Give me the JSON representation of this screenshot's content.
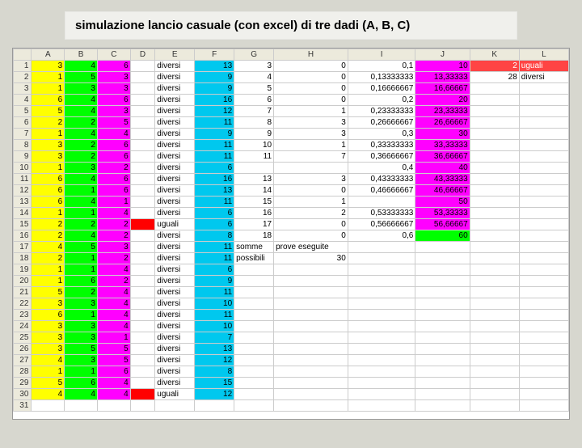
{
  "title": "simulazione lancio casuale (con excel) di tre dadi (A, B, C)",
  "columns": [
    "A",
    "B",
    "C",
    "D",
    "E",
    "F",
    "G",
    "H",
    "I",
    "J",
    "K",
    "L"
  ],
  "rows": [
    {
      "r": "1",
      "A": "3",
      "B": "4",
      "C": "6",
      "E": "diversi",
      "F": "13",
      "G": "3",
      "H": "0",
      "I": "0,1",
      "J": "10",
      "K": "2",
      "L": "uguali"
    },
    {
      "r": "2",
      "A": "1",
      "B": "5",
      "C": "3",
      "E": "diversi",
      "F": "9",
      "G": "4",
      "H": "0",
      "I": "0,13333333",
      "J": "13,33333",
      "K": "28",
      "L": "diversi"
    },
    {
      "r": "3",
      "A": "1",
      "B": "3",
      "C": "3",
      "E": "diversi",
      "F": "9",
      "G": "5",
      "H": "0",
      "I": "0,16666667",
      "J": "16,66667"
    },
    {
      "r": "4",
      "A": "6",
      "B": "4",
      "C": "6",
      "E": "diversi",
      "F": "16",
      "G": "6",
      "H": "0",
      "I": "0,2",
      "J": "20"
    },
    {
      "r": "5",
      "A": "5",
      "B": "4",
      "C": "3",
      "E": "diversi",
      "F": "12",
      "G": "7",
      "H": "1",
      "I": "0,23333333",
      "J": "23,33333"
    },
    {
      "r": "6",
      "A": "2",
      "B": "2",
      "C": "5",
      "E": "diversi",
      "F": "11",
      "G": "8",
      "H": "3",
      "I": "0,26666667",
      "J": "26,66667"
    },
    {
      "r": "7",
      "A": "1",
      "B": "4",
      "C": "4",
      "E": "diversi",
      "F": "9",
      "G": "9",
      "H": "3",
      "I": "0,3",
      "J": "30"
    },
    {
      "r": "8",
      "A": "3",
      "B": "2",
      "C": "6",
      "E": "diversi",
      "F": "11",
      "G": "10",
      "H": "1",
      "I": "0,33333333",
      "J": "33,33333"
    },
    {
      "r": "9",
      "A": "3",
      "B": "2",
      "C": "6",
      "E": "diversi",
      "F": "11",
      "G": "11",
      "H": "7",
      "I": "0,36666667",
      "J": "36,66667"
    },
    {
      "r": "10",
      "A": "1",
      "B": "3",
      "C": "2",
      "E": "diversi",
      "F": "6",
      "G": "",
      "H": "",
      "I": "0,4",
      "J": "40"
    },
    {
      "r": "11",
      "A": "6",
      "B": "4",
      "C": "6",
      "E": "diversi",
      "F": "16",
      "G": "13",
      "H": "3",
      "I": "0,43333333",
      "J": "43,33333"
    },
    {
      "r": "12",
      "A": "6",
      "B": "1",
      "C": "6",
      "E": "diversi",
      "F": "13",
      "G": "14",
      "H": "0",
      "I": "0,46666667",
      "J": "46,66667"
    },
    {
      "r": "13",
      "A": "6",
      "B": "4",
      "C": "1",
      "E": "diversi",
      "F": "11",
      "G": "15",
      "H": "1",
      "I": "",
      "J": "50"
    },
    {
      "r": "14",
      "A": "1",
      "B": "1",
      "C": "4",
      "E": "diversi",
      "F": "6",
      "G": "16",
      "H": "2",
      "I": "0,53333333",
      "J": "53,33333"
    },
    {
      "r": "15",
      "A": "2",
      "B": "2",
      "C": "2",
      "Dred": true,
      "E": "uguali",
      "F": "6",
      "G": "17",
      "H": "0",
      "I": "0,56666667",
      "J": "56,66667"
    },
    {
      "r": "16",
      "A": "2",
      "B": "4",
      "C": "2",
      "E": "diversi",
      "F": "8",
      "G": "18",
      "H": "0",
      "I": "0,6",
      "J": "60"
    },
    {
      "r": "17",
      "A": "4",
      "B": "5",
      "C": "3",
      "E": "diversi",
      "F": "11",
      "G": "somme",
      "H": "prove eseguite"
    },
    {
      "r": "18",
      "A": "2",
      "B": "1",
      "C": "2",
      "E": "diversi",
      "F": "11",
      "G": "possibili",
      "H": "30"
    },
    {
      "r": "19",
      "A": "1",
      "B": "1",
      "C": "4",
      "E": "diversi",
      "F": "6"
    },
    {
      "r": "20",
      "A": "1",
      "B": "6",
      "C": "2",
      "E": "diversi",
      "F": "9"
    },
    {
      "r": "21",
      "A": "5",
      "B": "2",
      "C": "4",
      "E": "diversi",
      "F": "11"
    },
    {
      "r": "22",
      "A": "3",
      "B": "3",
      "C": "4",
      "E": "diversi",
      "F": "10"
    },
    {
      "r": "23",
      "A": "6",
      "B": "1",
      "C": "4",
      "E": "diversi",
      "F": "11"
    },
    {
      "r": "24",
      "A": "3",
      "B": "3",
      "C": "4",
      "E": "diversi",
      "F": "10"
    },
    {
      "r": "25",
      "A": "3",
      "B": "3",
      "C": "1",
      "E": "diversi",
      "F": "7"
    },
    {
      "r": "26",
      "A": "3",
      "B": "5",
      "C": "5",
      "E": "diversi",
      "F": "13"
    },
    {
      "r": "27",
      "A": "4",
      "B": "3",
      "C": "5",
      "E": "diversi",
      "F": "12"
    },
    {
      "r": "28",
      "A": "1",
      "B": "1",
      "C": "6",
      "E": "diversi",
      "F": "8"
    },
    {
      "r": "29",
      "A": "5",
      "B": "6",
      "C": "4",
      "E": "diversi",
      "F": "15"
    },
    {
      "r": "30",
      "A": "4",
      "B": "4",
      "C": "4",
      "Dred": true,
      "E": "uguali",
      "F": "12"
    },
    {
      "r": "31"
    }
  ],
  "pinkJ": [
    true,
    true,
    true,
    true,
    true,
    true,
    true,
    true,
    true,
    true,
    true,
    true,
    true,
    true,
    true,
    true
  ],
  "greenJLast": true
}
